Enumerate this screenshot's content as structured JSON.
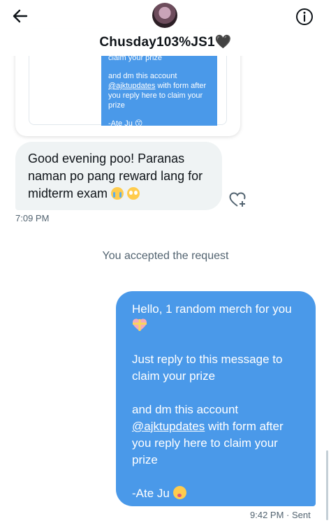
{
  "header": {
    "title": "Chusday103%JS1🖤"
  },
  "quoted_preview": {
    "line1_cut": "claim your prize",
    "line2": "and dm this account",
    "handle": "@ajktupdates",
    "line3": " with form after you reply here to claim your prize",
    "signoff_cut": "-Ate Ju 😙"
  },
  "received_message": {
    "line1": "Good evening poo! Paranas",
    "line2": "naman po pang reward lang for",
    "line3": "midterm exam ",
    "timestamp": "7:09 PM"
  },
  "system_message": "You accepted the request",
  "sent_message": {
    "line1": "Hello, 1 random merch for you",
    "line2": "Just reply to this message to claim your prize",
    "line3a": "and dm this account",
    "handle": "@ajktupdates",
    "line3b": " with form after you reply here to claim your prize",
    "signoff": "-Ate Ju ",
    "time": "9:42 PM",
    "status": "Sent"
  },
  "icons": {
    "back": "back-arrow-icon",
    "info": "info-icon",
    "react": "heart-plus-icon"
  },
  "colors": {
    "sent_bubble": "#4a99e9",
    "received_bubble": "#eff3f4",
    "meta_text": "#536471"
  }
}
